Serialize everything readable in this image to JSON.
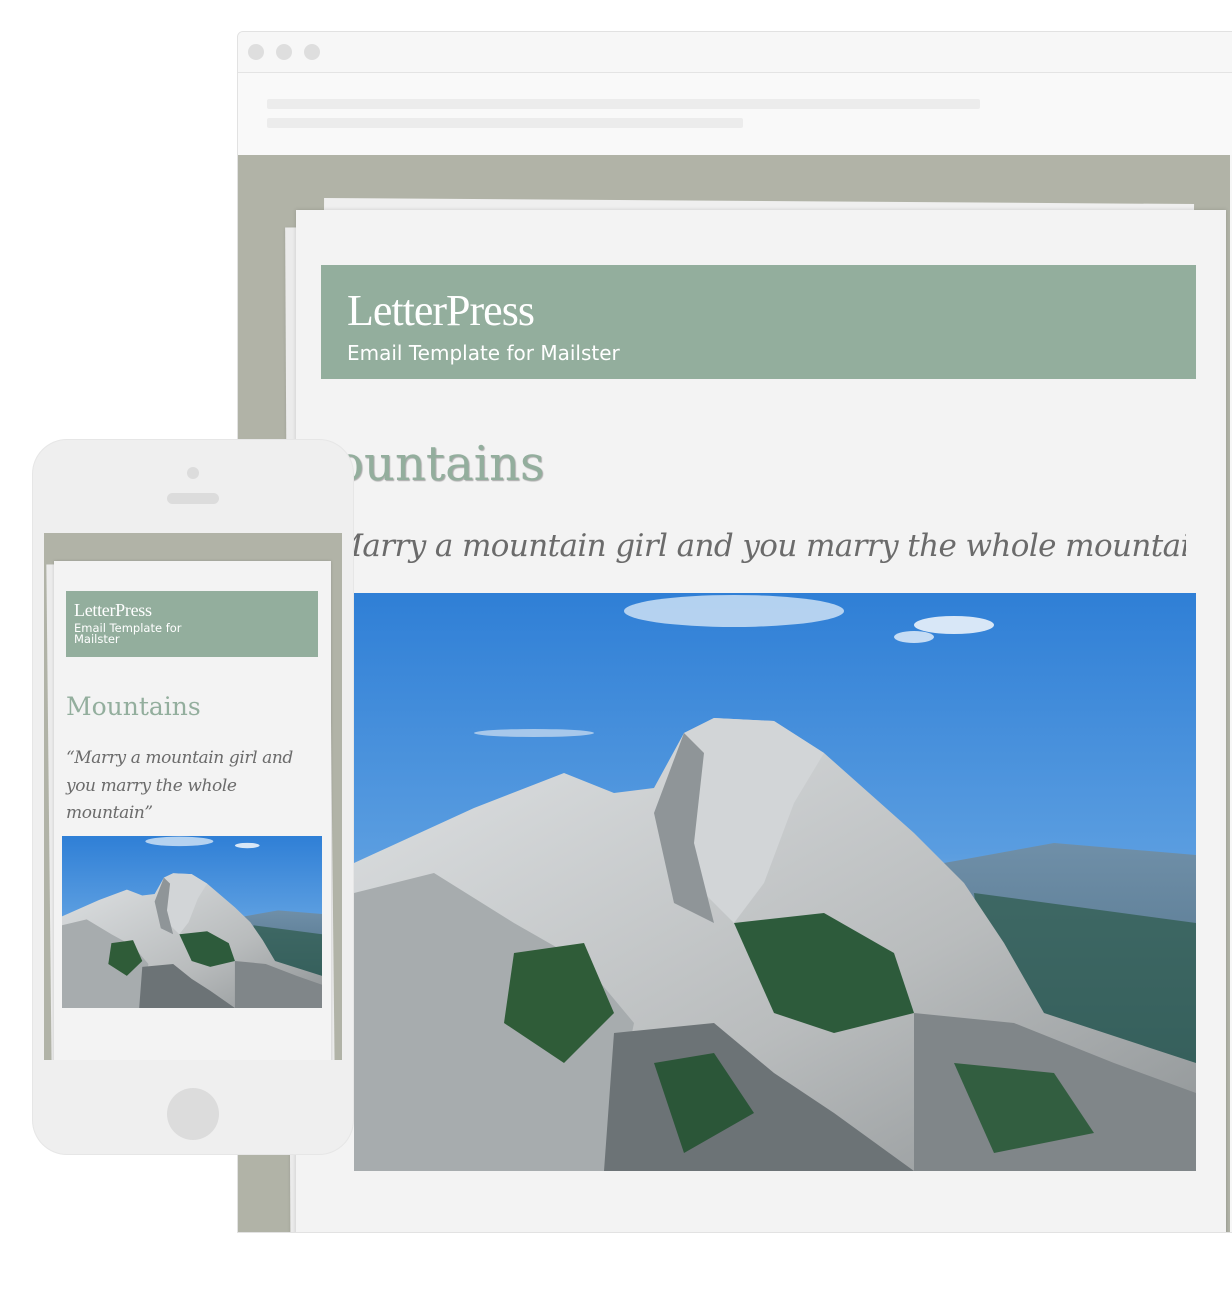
{
  "desktop": {
    "brand": "LetterPress",
    "tagline": "Email Template for Mailster",
    "heading": "Mountains",
    "quote": "“Marry a mountain girl and you marry the whole mountain”",
    "hero_alt": "Half Dome mountain under blue sky"
  },
  "mobile": {
    "brand": "LetterPress",
    "tagline": "Email Template for Mailster",
    "heading": "Mountains",
    "quote": "“Marry a mountain girl and you marry the whole mountain”",
    "hero_alt": "Half Dome mountain under blue sky"
  },
  "colors": {
    "accent": "#93ae9d",
    "backdrop": "#b1b3a7",
    "paper": "#f3f3f3",
    "quote_text": "#6b6b6b"
  }
}
